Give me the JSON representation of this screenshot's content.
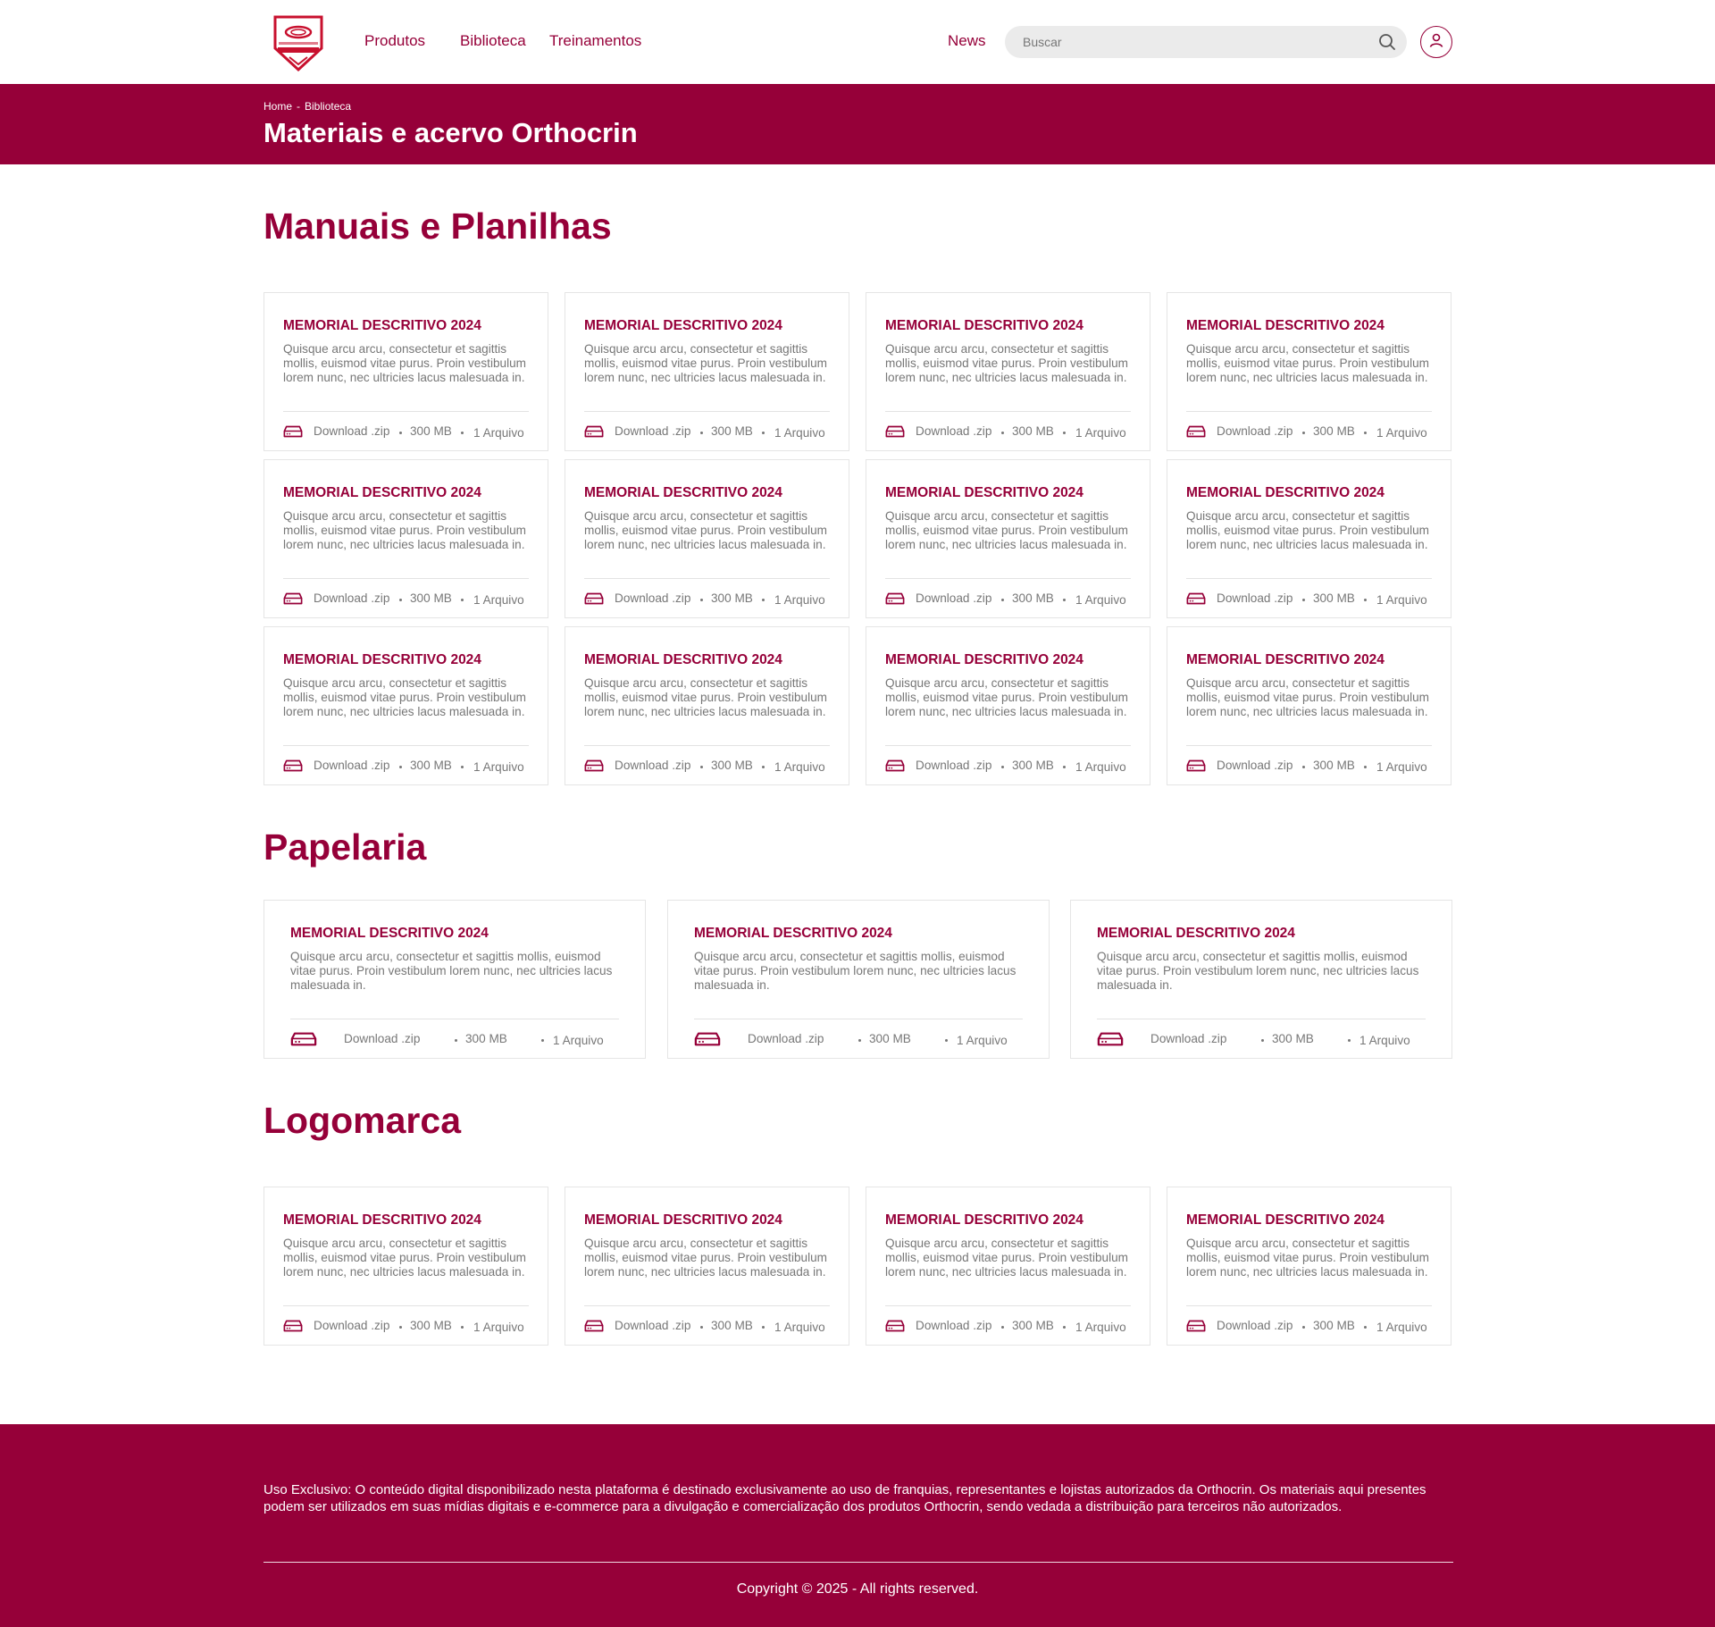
{
  "header": {
    "logo_alt": "Universidade Orthocrin",
    "nav": {
      "produtos": "Produtos",
      "biblioteca": "Biblioteca",
      "treinamentos": "Treinamentos",
      "news": "News"
    },
    "search_placeholder": "Buscar",
    "icons": {
      "search": "search-icon",
      "user": "user-icon"
    }
  },
  "hero": {
    "breadcrumb": [
      "Home",
      "Biblioteca"
    ],
    "breadcrumb_sep": "-",
    "title": "Materiais e acervo Orthocrin"
  },
  "sections": {
    "manuais": {
      "title": "Manuais e Planilhas"
    },
    "papelaria": {
      "title": "Papelaria"
    },
    "logomarca": {
      "title": "Logomarca"
    }
  },
  "card": {
    "title": "MEMORIAL DESCRITIVO 2024",
    "description": "Quisque arcu arcu, consectetur et sagittis mollis, euismod vitae purus. Proin vestibulum lorem nunc, nec ultricies lacus malesuada in.",
    "download_label": "Download .zip",
    "size": "300 MB",
    "files": "1 Arquivo",
    "icon": "hard-drive-icon"
  },
  "footer": {
    "notice": "Uso Exclusivo: O conteúdo digital disponibilizado nesta plataforma é destinado exclusivamente ao uso de franquias, representantes e lojistas autorizados da Orthocrin. Os materiais aqui presentes podem ser utilizados em suas mídias digitais e e-commerce para a divulgação e comercialização dos produtos Orthocrin, sendo vedada a distribuição para terceiros não autorizados.",
    "copyright": "Copyright © 2025 - All rights reserved."
  },
  "colors": {
    "brand": "#960039",
    "text_muted": "#777777",
    "search_bg": "#ebebeb"
  }
}
